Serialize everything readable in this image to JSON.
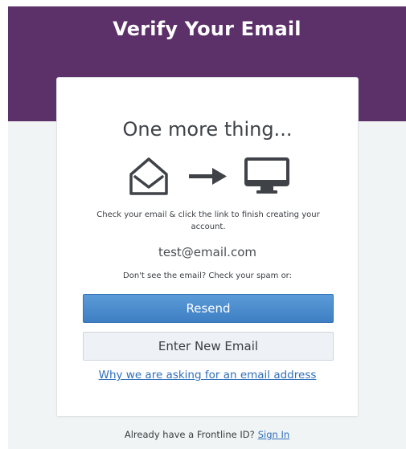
{
  "header": {
    "title": "Verify Your Email"
  },
  "card": {
    "heading": "One more thing...",
    "icons": [
      "envelope-open-icon",
      "arrow-right-icon",
      "monitor-icon"
    ],
    "instructions": "Check your email & click the link to finish creating your account.",
    "email": "test@email.com",
    "spam_note": "Don't see the email? Check your spam or:",
    "resend_label": "Resend",
    "enter_new_email_label": "Enter New Email",
    "why_link": "Why we are asking for an email address"
  },
  "footer": {
    "prompt": "Already have a Frontline ID?",
    "signin_label": "Sign In"
  },
  "colors": {
    "header_bg": "#5c3068",
    "page_bg": "#f1f4f4",
    "primary_button": "#4a8bcf",
    "link": "#2f6fba",
    "icon": "#3f4348"
  }
}
